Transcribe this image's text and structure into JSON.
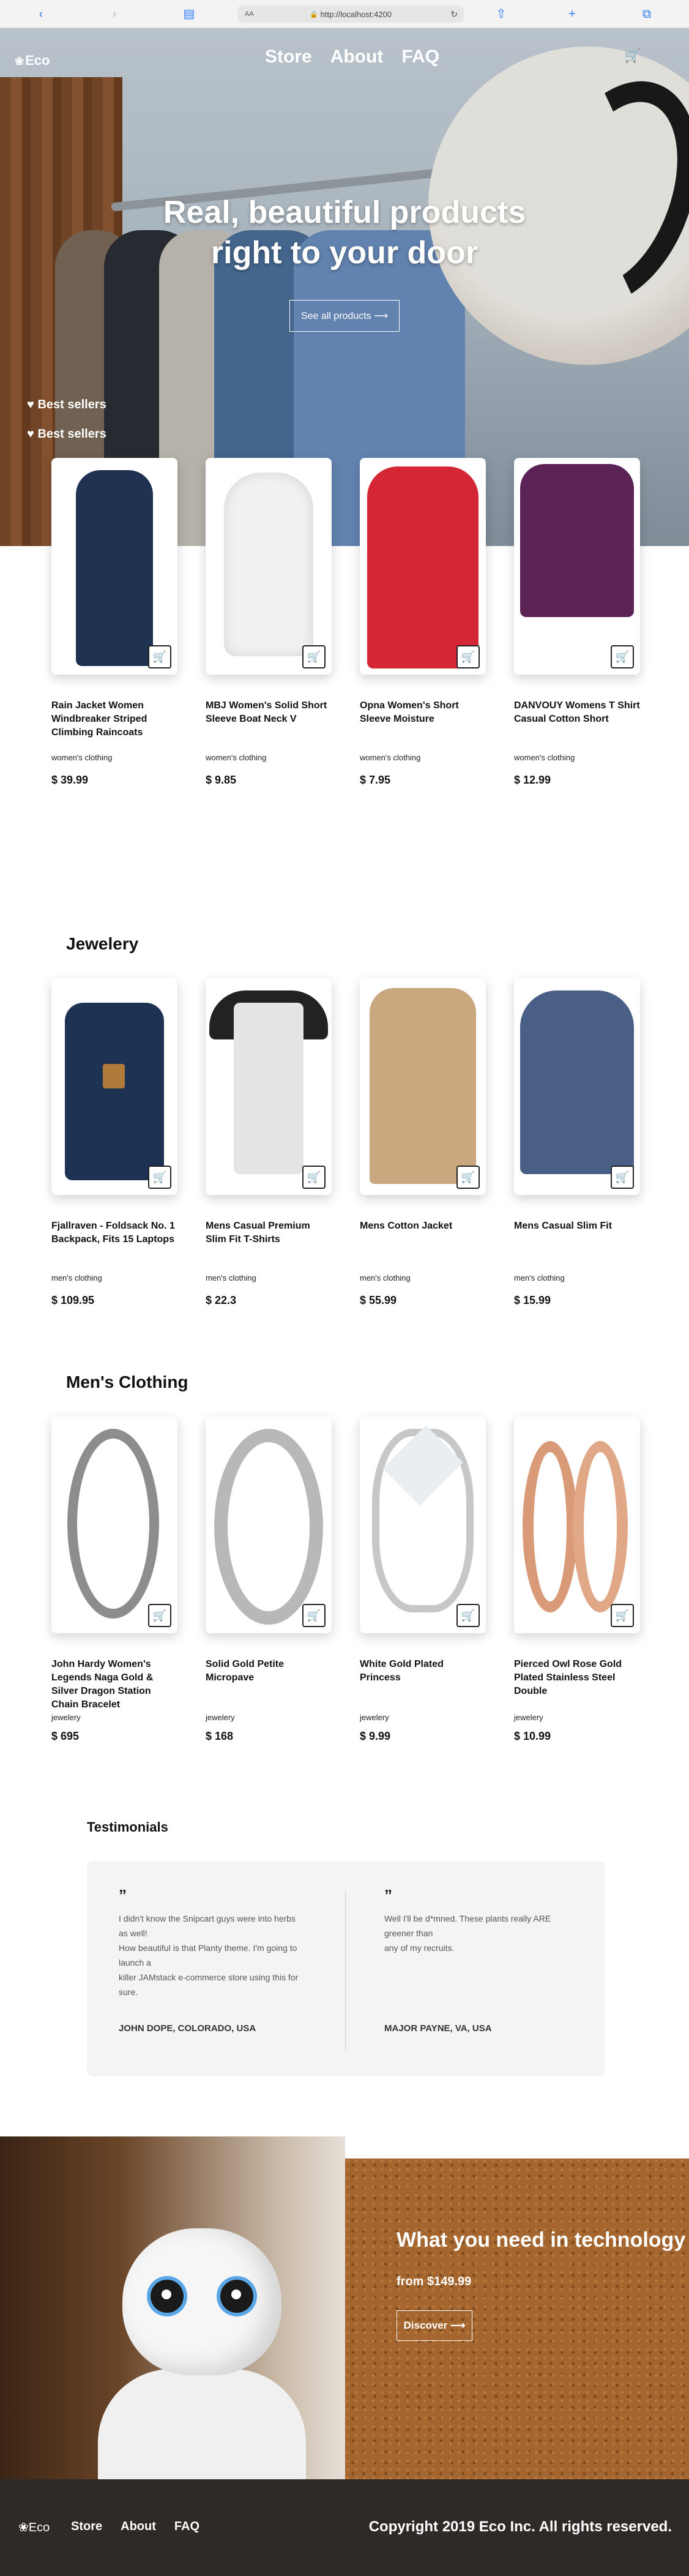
{
  "browser": {
    "text_size": "AA",
    "url": "http://localhost:4200"
  },
  "nav": {
    "logo": "Eco",
    "links": [
      "Store",
      "About",
      "FAQ"
    ]
  },
  "hero": {
    "title_line1": "Real, beautiful products",
    "title_line2": "right to your door",
    "button": "See all products ⟶",
    "best_sellers_1": "Best sellers",
    "best_sellers_2": "Best sellers"
  },
  "best_sellers": [
    {
      "title": "Rain Jacket Women Windbreaker Striped Climbing Raincoats",
      "category": "women's clothing",
      "price": "$ 39.99"
    },
    {
      "title": "MBJ Women's Solid Short Sleeve Boat Neck V",
      "category": "women's clothing",
      "price": "$ 9.85"
    },
    {
      "title": "Opna Women's Short Sleeve Moisture",
      "category": "women's clothing",
      "price": "$ 7.95"
    },
    {
      "title": "DANVOUY Womens T Shirt Casual Cotton Short",
      "category": "women's clothing",
      "price": "$ 12.99"
    }
  ],
  "jewelery": {
    "heading": "Jewelery",
    "items": [
      {
        "title": "Fjallraven - Foldsack No. 1 Backpack, Fits 15 Laptops",
        "category": "men's clothing",
        "price": "$ 109.95"
      },
      {
        "title": "Mens Casual Premium Slim Fit T-Shirts",
        "category": "men's clothing",
        "price": "$ 22.3"
      },
      {
        "title": "Mens Cotton Jacket",
        "category": "men's clothing",
        "price": "$ 55.99"
      },
      {
        "title": "Mens Casual Slim Fit",
        "category": "men's clothing",
        "price": "$ 15.99"
      }
    ]
  },
  "mens_clothing": {
    "heading": "Men's Clothing",
    "items": [
      {
        "title": "John Hardy Women's Legends Naga Gold & Silver Dragon Station Chain Bracelet",
        "category": "jewelery",
        "price": "$ 695"
      },
      {
        "title": "Solid Gold Petite Micropave",
        "category": "jewelery",
        "price": "$ 168"
      },
      {
        "title": "White Gold Plated Princess",
        "category": "jewelery",
        "price": "$ 9.99"
      },
      {
        "title": "Pierced Owl Rose Gold Plated Stainless Steel Double",
        "category": "jewelery",
        "price": "$ 10.99"
      }
    ]
  },
  "testimonials": {
    "heading": "Testimonials",
    "quote_mark": "”",
    "items": [
      {
        "text1": "I didn't know the Snipcart guys were into herbs",
        "text2": "as well!",
        "text3": "How beautiful is that Planty theme. I'm going to",
        "text4": "launch a",
        "text5": "killer JAMstack e-commerce store using this for",
        "text6": "sure.",
        "author": "JOHN DOPE, COLORADO, USA"
      },
      {
        "text1": "Well I'll be d*mned. These plants really ARE",
        "text2": "greener than",
        "text3": "any of my recruits.",
        "author": "MAJOR PAYNE, VA, USA"
      }
    ]
  },
  "promo": {
    "title": "What you need in technology",
    "subtitle": "from $149.99",
    "button": "Discover ⟶"
  },
  "footer": {
    "logo": "Eco",
    "links": [
      "Store",
      "About",
      "FAQ"
    ],
    "copyright": "Copyright 2019 Eco Inc. All rights reserved."
  },
  "colors": {
    "footer_bg": "#2f2a28",
    "browser_accent": "#2f7cf6"
  }
}
